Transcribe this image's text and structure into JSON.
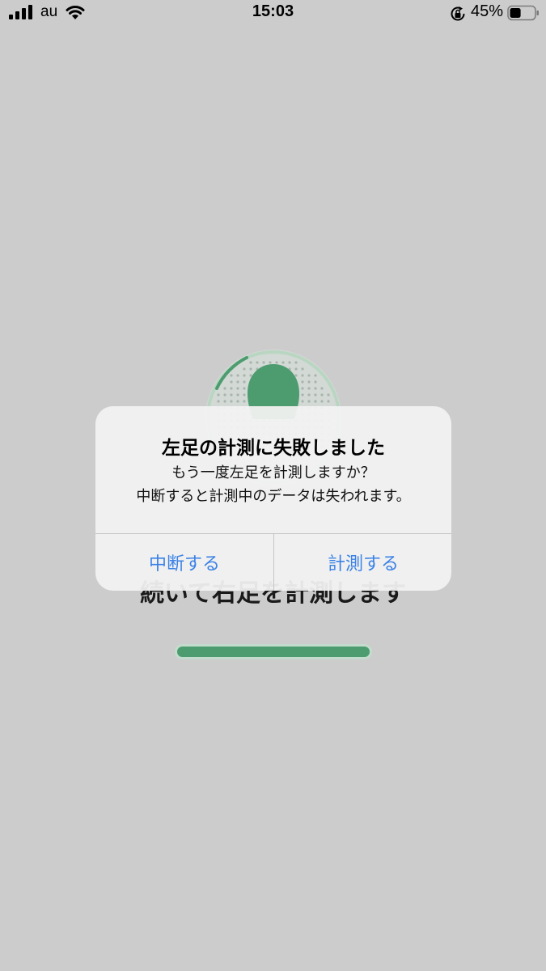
{
  "status_bar": {
    "carrier": "au",
    "time": "15:03",
    "battery_percent": "45%",
    "battery_level": 0.45,
    "icons": [
      "signal-icon",
      "wifi-icon",
      "rotation-lock-icon",
      "battery-icon"
    ]
  },
  "background_screen": {
    "instruction": "続いて右足を計測します",
    "progress": 1.0,
    "accent_color": "#4d9c6f"
  },
  "alert": {
    "title": "左足の計測に失敗しました",
    "message_line1": "もう一度左足を計測しますか？",
    "message_line2": "中断すると計測中のデータは失われます。",
    "cancel_label": "中断する",
    "confirm_label": "計測する",
    "button_color": "#3b82e6"
  },
  "dim_color": "#cccccc"
}
